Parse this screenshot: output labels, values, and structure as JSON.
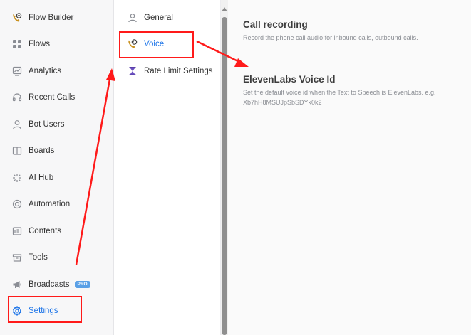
{
  "sidebar": {
    "items": [
      {
        "label": "Flow Builder",
        "icon": "phone-bot-icon"
      },
      {
        "label": "Flows",
        "icon": "grid-icon"
      },
      {
        "label": "Analytics",
        "icon": "analytics-icon"
      },
      {
        "label": "Recent Calls",
        "icon": "headset-icon"
      },
      {
        "label": "Bot Users",
        "icon": "user-icon"
      },
      {
        "label": "Boards",
        "icon": "boards-icon"
      },
      {
        "label": "AI Hub",
        "icon": "sparkle-icon"
      },
      {
        "label": "Automation",
        "icon": "automation-icon"
      },
      {
        "label": "Contents",
        "icon": "contents-icon"
      },
      {
        "label": "Tools",
        "icon": "toolbox-icon"
      },
      {
        "label": "Broadcasts",
        "icon": "megaphone-icon",
        "badge": "PRO"
      },
      {
        "label": "Settings",
        "icon": "gear-icon",
        "active": true
      }
    ]
  },
  "subnav": {
    "items": [
      {
        "label": "General",
        "icon": "user-icon"
      },
      {
        "label": "Voice",
        "icon": "phone-bot-icon",
        "active": true
      },
      {
        "label": "Rate Limit Settings",
        "icon": "hourglass-icon"
      }
    ]
  },
  "content": {
    "sections": [
      {
        "title": "Call recording",
        "description": "Record the phone call audio for inbound calls, outbound calls."
      },
      {
        "title": "ElevenLabs Voice Id",
        "description": "Set the default voice id when the Text to Speech is ElevenLabs. e.g. Xb7hH8MSUJpSbSDYk0k2"
      }
    ]
  },
  "colors": {
    "accent": "#1a73e8",
    "annotation": "#ff1a1a",
    "badge": "#5aa0e6"
  }
}
